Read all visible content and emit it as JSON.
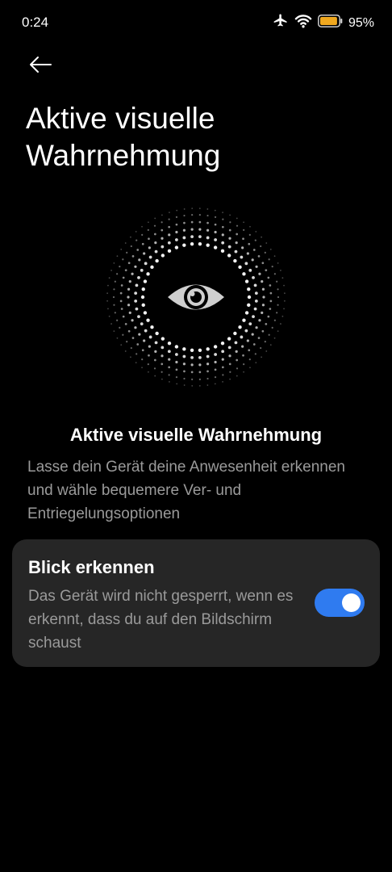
{
  "status_bar": {
    "time": "0:24",
    "battery_percent_text": "95%",
    "battery_level": 0.95,
    "battery_color": "#f0a81f",
    "icons": [
      "airplane-icon",
      "wifi-icon",
      "battery-icon"
    ]
  },
  "header": {
    "back_icon": "arrow-left-icon",
    "title": "Aktive visuelle Wahrnehmung"
  },
  "illustration": {
    "icon": "eye-icon"
  },
  "section": {
    "title": "Aktive visuelle Wahrnehmung",
    "description": "Lasse dein Gerät deine Anwesenheit erkennen und wähle bequemere Ver- und Entriegelungsoptionen"
  },
  "setting": {
    "title": "Blick erkennen",
    "description": "Das Gerät wird nicht gesperrt, wenn es erkennt, dass du auf den Bildschirm schaust",
    "enabled": true,
    "toggle_color": "#2f7bf0"
  }
}
